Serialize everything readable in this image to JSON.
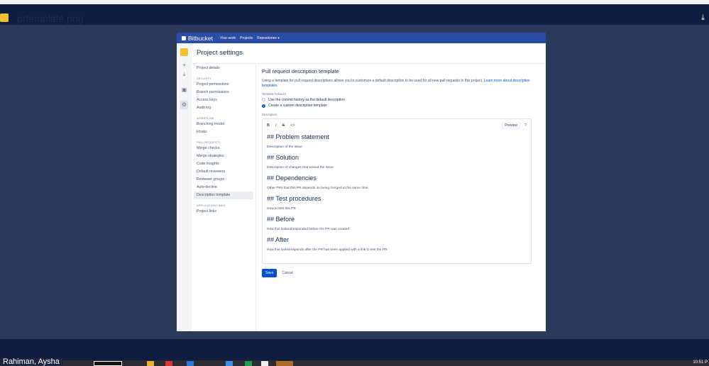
{
  "viewer": {
    "filename": "prtemplate.png",
    "download_icon": "download-icon"
  },
  "bitbucket": {
    "brand": "Bitbucket",
    "nav": [
      "Your work",
      "Projects",
      "Repositories ▾"
    ]
  },
  "page_title": "Project settings",
  "sidebar": {
    "project_details": "Project details",
    "security_heading": "SECURITY",
    "security": [
      "Project permissions",
      "Branch permissions",
      "Access keys",
      "Audit log"
    ],
    "workflow_heading": "WORKFLOW",
    "workflow": [
      "Branching model",
      "Hooks"
    ],
    "pr_heading": "PULL REQUESTS",
    "pr": [
      "Merge checks",
      "Merge strategies",
      "Code Insights",
      "Default reviewers",
      "Reviewer groups",
      "Auto-decline",
      "Description template"
    ],
    "app_heading": "APPLICATION LINKS",
    "app": [
      "Project links"
    ]
  },
  "main": {
    "title": "Pull request description template",
    "intro": "Using a template for pull request descriptions allows you to customize a default description to be used for all new pull requests in this project.",
    "learn_more": "Learn more about description templates",
    "behavior_label": "Template behavior",
    "option1": "Use the commit history as the default description",
    "option2": "Create a custom description template",
    "selected_option": 2,
    "description_label": "Description",
    "toolbar": {
      "bold": "B",
      "italic": "I",
      "strike": "S",
      "code": "<>",
      "preview": "Preview",
      "help": "?"
    },
    "sections": [
      {
        "h": "## Problem statement",
        "d": "Description of the issue"
      },
      {
        "h": "## Solution",
        "d": "Description of changes that solved the issue"
      },
      {
        "h": "## Dependencies",
        "d": "Other PRs that this PR depends on being merged at the same time"
      },
      {
        "h": "## Test procedures",
        "d": "How to test this PR"
      },
      {
        "h": "## Before",
        "d": "How this looked/responded before the PR was created"
      },
      {
        "h": "## After",
        "d": "How this looks/responds after the PR has been applied with a link to test the PR"
      }
    ],
    "save": "Save",
    "cancel": "Cancel"
  },
  "taskbar": {
    "user": "Rahiman, Aysha",
    "time": "10:51 P"
  }
}
